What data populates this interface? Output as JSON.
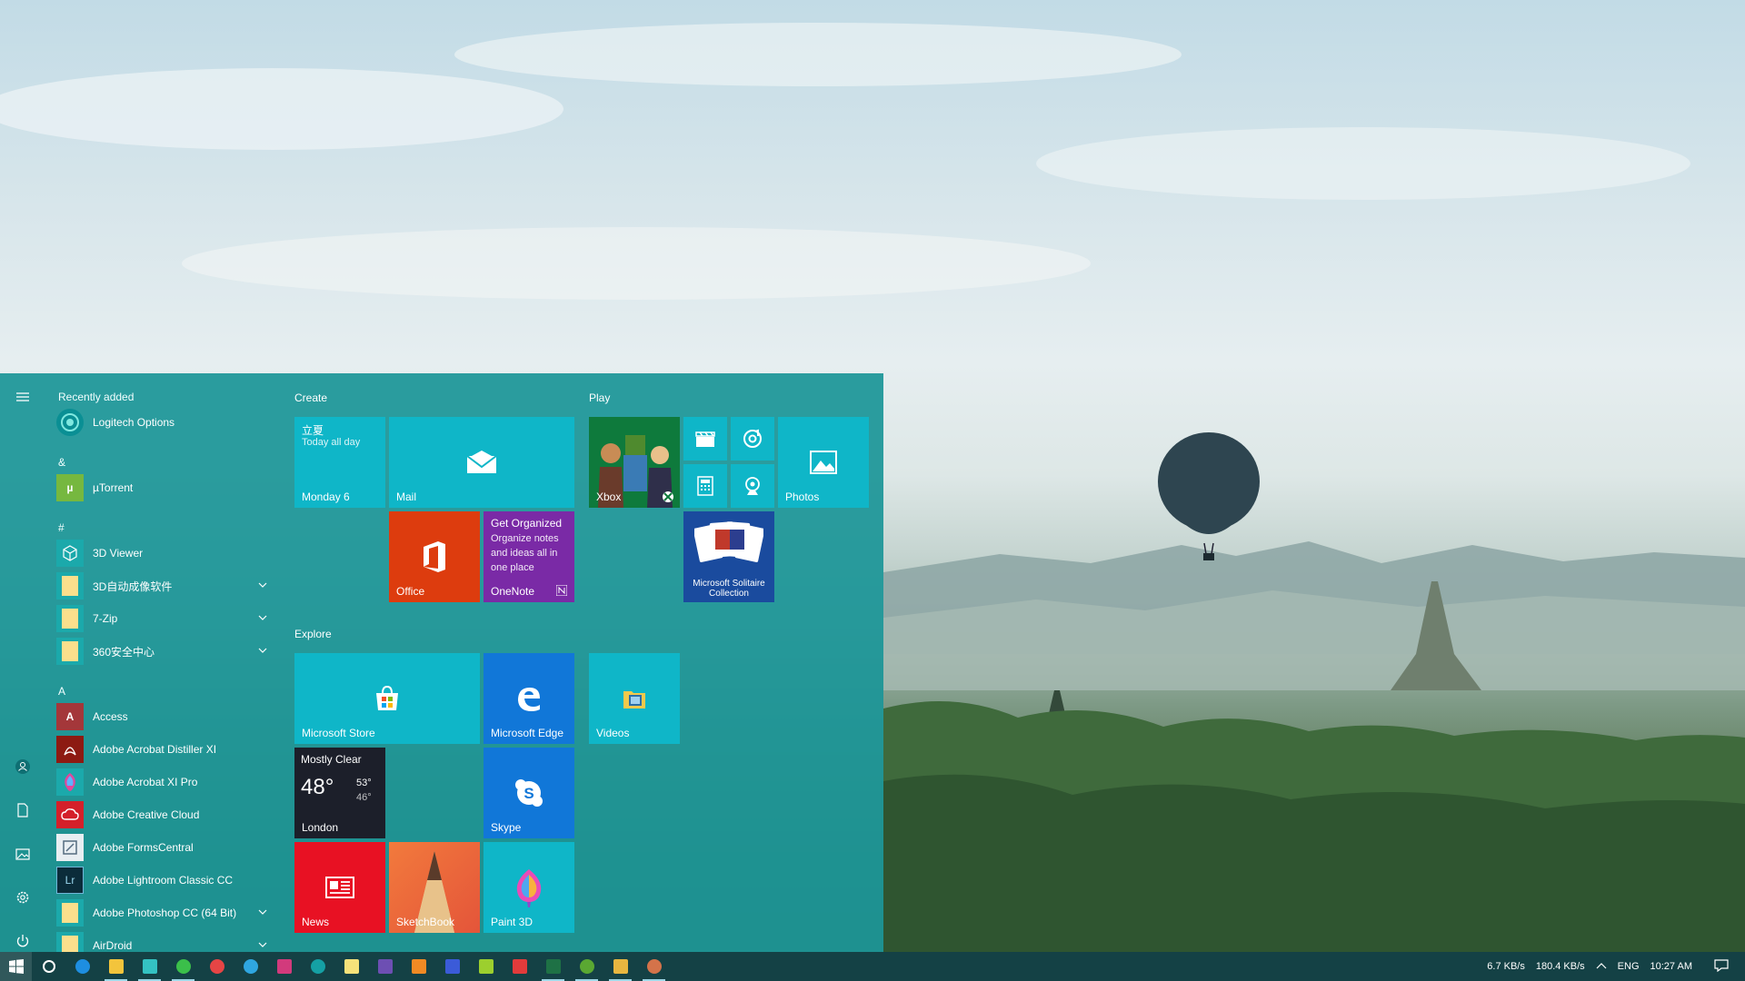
{
  "start_menu": {
    "rail": [
      "menu-icon",
      "user-icon",
      "documents-icon",
      "pictures-icon",
      "settings-icon",
      "power-icon"
    ],
    "sections": {
      "recently_added": "Recently added",
      "amp": "&",
      "hash": "#",
      "a": "A"
    },
    "apps": {
      "logitech": "Logitech Options",
      "utorrent": "µTorrent",
      "viewer3d": "3D Viewer",
      "cn3d": "3D自动成像软件",
      "zip7": "7-Zip",
      "s360": "360安全中心",
      "access": "Access",
      "distiller": "Adobe Acrobat Distiller XI",
      "acrobat": "Adobe Acrobat XI Pro",
      "creative": "Adobe Creative Cloud",
      "forms": "Adobe FormsCentral",
      "lightroom": "Adobe Lightroom Classic CC",
      "photoshop": "Adobe Photoshop CC (64 Bit)",
      "airdroid": "AirDroid"
    },
    "groups": {
      "create": "Create",
      "play": "Play",
      "explore": "Explore"
    },
    "tiles": {
      "calendar": {
        "event": "立夏",
        "sub": "Today all day",
        "label": "Monday 6"
      },
      "mail": "Mail",
      "xbox": "Xbox",
      "photos": "Photos",
      "office": "Office",
      "onenote": {
        "title": "Get Organized",
        "body": "Organize notes and ideas all in one place",
        "label": "OneNote"
      },
      "solitaire": "Microsoft Solitaire Collection",
      "store": "Microsoft Store",
      "edge": "Microsoft Edge",
      "videos": "Videos",
      "weather": {
        "condition": "Mostly Clear",
        "temp": "48°",
        "high": "53°",
        "low": "46°",
        "city": "London"
      },
      "skype": "Skype",
      "news": "News",
      "sketchbook": "SketchBook",
      "paint3d": "Paint 3D"
    }
  },
  "taskbar": {
    "net_down": "6.7 KB/s",
    "net_up": "180.4 KB/s",
    "lang": "ENG",
    "time": "10:27 AM"
  },
  "colors": {
    "start_bg": "#1c9698",
    "tile_teal": "#0fb6c8",
    "taskbar": "#0c3a3e"
  }
}
